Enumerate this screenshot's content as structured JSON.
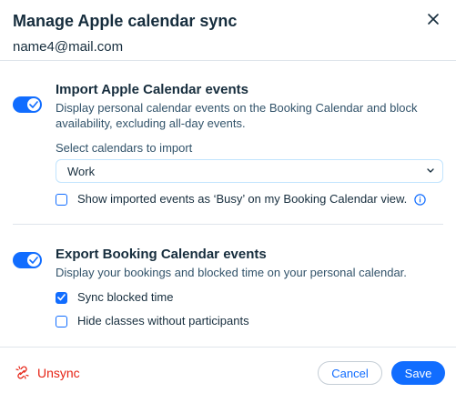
{
  "modal": {
    "title": "Manage Apple calendar sync",
    "subtitle": "name4@mail.com"
  },
  "import_section": {
    "toggle_on": true,
    "title": "Import Apple Calendar events",
    "description": "Display personal calendar events on the Booking Calendar and block availability, excluding all-day events.",
    "select_label": "Select calendars to import",
    "select_value": "Work",
    "show_busy_label": "Show imported events as ‘Busy’ on my Booking Calendar view.",
    "show_busy_checked": false
  },
  "export_section": {
    "toggle_on": true,
    "title": "Export Booking Calendar events",
    "description": "Display your bookings and blocked time on your personal calendar.",
    "options": [
      {
        "label": "Sync blocked time",
        "checked": true
      },
      {
        "label": "Hide classes without participants",
        "checked": false
      }
    ]
  },
  "footer": {
    "unsync_label": "Unsync",
    "cancel_label": "Cancel",
    "save_label": "Save"
  },
  "colors": {
    "accent": "#116dff",
    "danger": "#e62214",
    "text": "#162d3d",
    "divider": "#dfe5eb"
  },
  "icons": {
    "close": "close-icon",
    "chevron": "chevron-down-icon",
    "info": "info-icon",
    "unsync": "broken-link-icon",
    "toggle_check": "check-icon"
  }
}
